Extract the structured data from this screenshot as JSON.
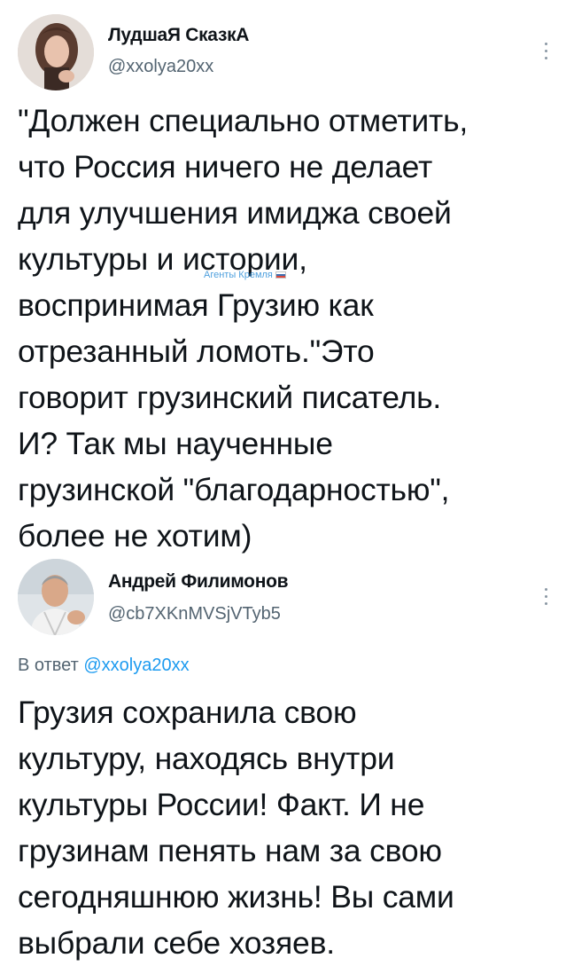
{
  "tweets": [
    {
      "display_name": "ЛудшаЯ СказкА",
      "handle": "@xxolya20xx",
      "more_icon": "more-vertical-icon",
      "text": "\"Должен специально отметить,\nчто Россия ничего не делает\nдля улучшения имиджа своей\nкультуры и истории,\nвоспринимая Грузию как\nотрезанный ломоть.\"Это\nговорит грузинский писатель.\nИ?  Так мы наученные\nгрузинской \"благодарностью\",\nболее  не хотим)",
      "watermark": "Агенты Кремля"
    },
    {
      "display_name": "Андрей Филимонов",
      "handle": "@cb7XKnMVSjVTyb5",
      "more_icon": "more-vertical-icon",
      "reply_prefix": "В ответ",
      "reply_handle": "@xxolya20xx",
      "text": "Грузия сохранила свою\nкультуру, находясь внутри\nкультуры России! Факт. И не\nгрузинам пенять нам за свою\nсегодняшнюю жизнь! Вы сами\nвыбрали себе хозяев."
    }
  ],
  "colors": {
    "text": "#0f1419",
    "secondary": "#536471",
    "link": "#1d9bf0"
  }
}
